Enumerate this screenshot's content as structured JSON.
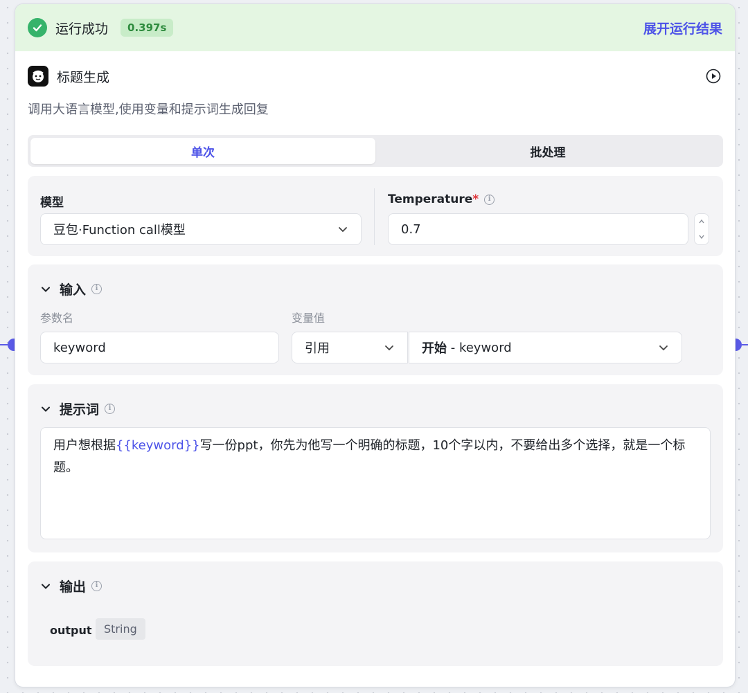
{
  "status": {
    "text": "运行成功",
    "time": "0.397s",
    "expand_label": "展开运行结果",
    "color": "#36b36b"
  },
  "node": {
    "title": "标题生成",
    "description": "调用大语言模型,使用变量和提示词生成回复"
  },
  "tabs": [
    {
      "label": "单次",
      "active": true
    },
    {
      "label": "批处理",
      "active": false
    }
  ],
  "settings": {
    "model_label": "模型",
    "model_value": "豆包·Function call模型",
    "temperature_label": "Temperature",
    "temperature_required": "*",
    "temperature_value": "0.7"
  },
  "input": {
    "title": "输入",
    "param_col": "参数名",
    "value_col": "变量值",
    "param_name": "keyword",
    "ref_type": "引用",
    "ref_source": "开始",
    "ref_sep": " - ",
    "ref_var": "keyword"
  },
  "prompt": {
    "title": "提示词",
    "text_before": "用户想根据",
    "variable": "{{keyword}}",
    "text_after": "写一份ppt，你先为他写一个明确的标题，10个字以内，不要给出多个选择，就是一个标题。"
  },
  "output": {
    "title": "输出",
    "name": "output",
    "type": "String"
  },
  "colors": {
    "accent": "#4d53e8",
    "success_bg": "#e4f6e2",
    "port": "#5a5ae6"
  },
  "icons": [
    "check-circle-icon",
    "robot-avatar-icon",
    "play-circle-icon",
    "chevron-down-icon",
    "info-icon",
    "stepper-icon"
  ]
}
